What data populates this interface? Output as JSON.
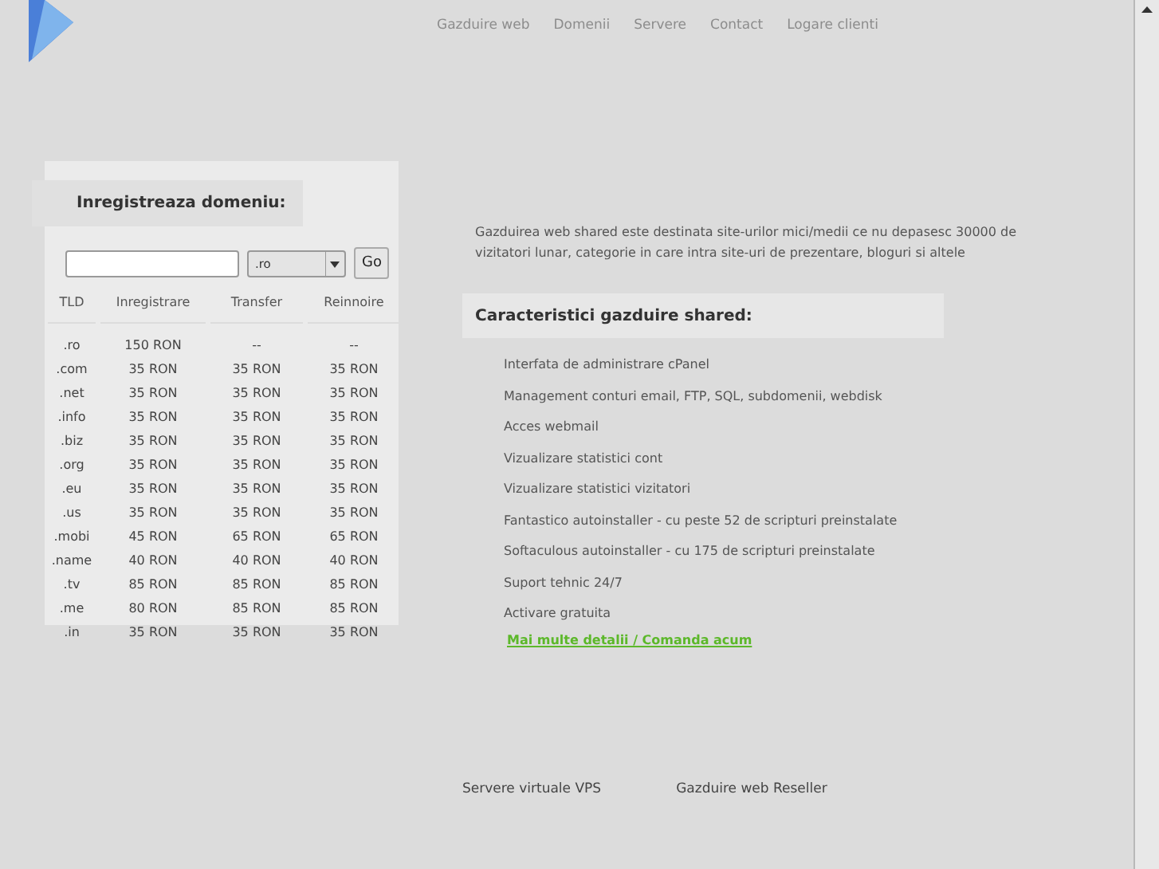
{
  "nav": [
    "Gazduire web",
    "Domenii",
    "Servere",
    "Contact",
    "Logare clienti"
  ],
  "domain_panel": {
    "title": "Inregistreaza domeniu:",
    "tld_select": ".ro",
    "go": "Go",
    "table": {
      "columns": [
        "TLD",
        "Inregistrare",
        "Transfer",
        "Reinnoire"
      ],
      "rows": [
        [
          ".ro",
          "150 RON",
          "--",
          "--"
        ],
        [
          ".com",
          "35 RON",
          "35 RON",
          "35 RON"
        ],
        [
          ".net",
          "35 RON",
          "35 RON",
          "35 RON"
        ],
        [
          ".info",
          "35 RON",
          "35 RON",
          "35 RON"
        ],
        [
          ".biz",
          "35 RON",
          "35 RON",
          "35 RON"
        ],
        [
          ".org",
          "35 RON",
          "35 RON",
          "35 RON"
        ],
        [
          ".eu",
          "35 RON",
          "35 RON",
          "35 RON"
        ],
        [
          ".us",
          "35 RON",
          "35 RON",
          "35 RON"
        ],
        [
          ".mobi",
          "45 RON",
          "65 RON",
          "65 RON"
        ],
        [
          ".name",
          "40 RON",
          "40 RON",
          "40 RON"
        ],
        [
          ".tv",
          "85 RON",
          "85 RON",
          "85 RON"
        ],
        [
          ".me",
          "80 RON",
          "85 RON",
          "85 RON"
        ],
        [
          ".in",
          "35 RON",
          "35 RON",
          "35 RON"
        ]
      ]
    }
  },
  "intro": "Gazduirea web shared este destinata site-urilor mici/medii ce nu depasesc 30000 de vizitatori lunar, categorie in care intra site-uri de prezentare, bloguri si altele",
  "features": {
    "title": "Caracteristici gazduire shared:",
    "items": [
      "Interfata de administrare cPanel",
      "Management conturi email, FTP, SQL, subdomenii, webdisk",
      "Acces webmail",
      "Vizualizare statistici cont",
      "Vizualizare statistici vizitatori",
      "Fantastico autoinstaller - cu peste 52 de scripturi preinstalate",
      "Softaculous autoinstaller - cu 175 de scripturi preinstalate",
      "Suport tehnic 24/7",
      "Activare gratuita"
    ],
    "link": "Mai multe detalii / Comanda acum"
  },
  "footer_links": [
    "Servere virtuale VPS",
    "Gazduire web Reseller"
  ]
}
